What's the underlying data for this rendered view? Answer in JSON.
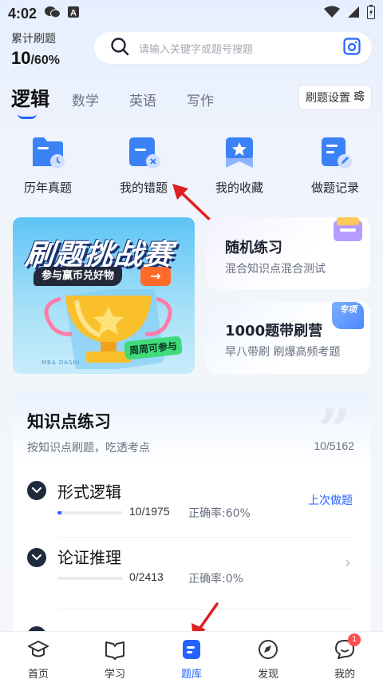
{
  "status": {
    "time": "4:02"
  },
  "stats": {
    "label": "累计刷题",
    "count": "10",
    "total": "/60%"
  },
  "search": {
    "placeholder": "请输入关键字或题号搜题"
  },
  "subjects": {
    "logic": "逻辑",
    "math": "数学",
    "english": "英语",
    "writing": "写作",
    "settings": "刷题设置"
  },
  "quick": [
    {
      "label": "历年真题",
      "icon": "folder-clock-icon"
    },
    {
      "label": "我的错题",
      "icon": "error-book-icon"
    },
    {
      "label": "我的收藏",
      "icon": "star-bookmark-icon"
    },
    {
      "label": "做题记录",
      "icon": "record-edit-icon"
    }
  ],
  "banner": {
    "title": "刷题挑战赛",
    "pill": "参与赢币兑好物",
    "tag": "周周可参与",
    "brand": "MBA DASHI"
  },
  "cards": {
    "random": {
      "title": "随机练习",
      "sub": "混合知识点混合测试"
    },
    "camp": {
      "title": "1000题带刷营",
      "sub": "早八带刷  刷爆高频考题",
      "badge": "专项"
    }
  },
  "knowledge": {
    "title": "知识点练习",
    "sub": "按知识点刷题，吃透考点",
    "count": "10/5162",
    "items": [
      {
        "name": "形式逻辑",
        "progress": "10/1975",
        "rate": "正确率:60%",
        "fill": 0.005,
        "action": "上次做题"
      },
      {
        "name": "论证推理",
        "progress": "0/2413",
        "rate": "正确率:0%",
        "fill": 0,
        "action": ""
      }
    ]
  },
  "nav": [
    {
      "label": "首页",
      "icon": "graduation-cap-icon"
    },
    {
      "label": "学习",
      "icon": "open-book-icon"
    },
    {
      "label": "题库",
      "icon": "question-bank-icon"
    },
    {
      "label": "发现",
      "icon": "compass-icon"
    },
    {
      "label": "我的",
      "icon": "chat-face-icon",
      "badge": "1"
    }
  ],
  "colors": {
    "accent": "#2563ff",
    "annotation": "#e02020",
    "badge": "#ff4d4f"
  }
}
